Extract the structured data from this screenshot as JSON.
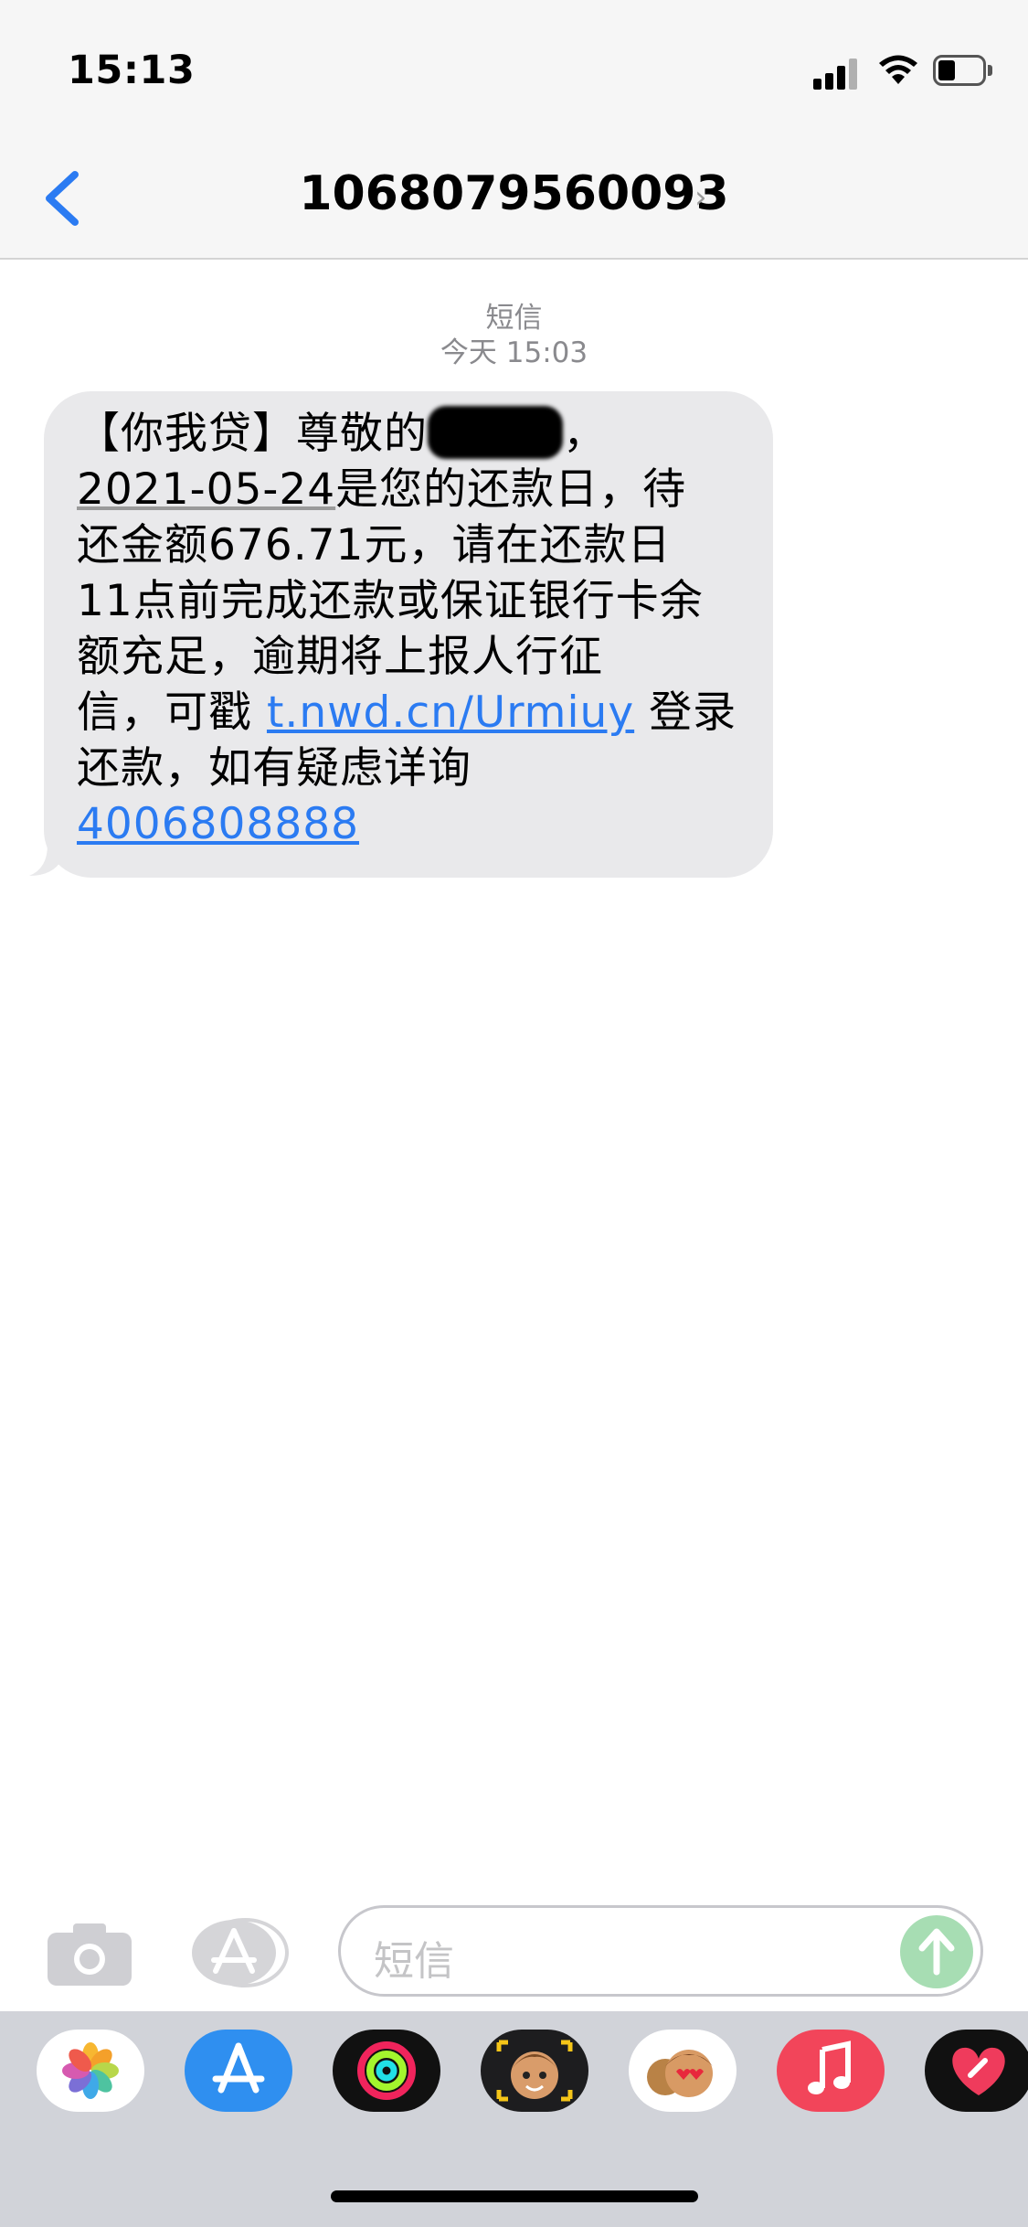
{
  "status_bar": {
    "time": "15:13"
  },
  "nav": {
    "title": "1068079560093",
    "chevron": "›"
  },
  "conversation": {
    "service_label": "短信",
    "timestamp": "今天 15:03"
  },
  "message": {
    "line1_prefix": "【你我贷】尊敬的",
    "line1_suffix": "，",
    "date": "2021-05-24",
    "line2_rest": "是您的还款日，待",
    "line3": "还金额676.71元，请在还款日",
    "line4": "11点前完成还款或保证银行卡余",
    "line5": "额充足，逾期将上报人行征",
    "line6_prefix": "信，可戳 ",
    "url": "t.nwd.cn/Urmiuy",
    "line6_suffix": " 登录",
    "line7": "还款，如有疑虑详询",
    "phone": "4006808888"
  },
  "input": {
    "placeholder": "短信"
  },
  "app_tray": [
    {
      "icon": "photos-icon"
    },
    {
      "icon": "app-store-icon"
    },
    {
      "icon": "activity-icon"
    },
    {
      "icon": "memoji-camera-icon"
    },
    {
      "icon": "memoji-stickers-icon"
    },
    {
      "icon": "music-icon"
    },
    {
      "icon": "digital-touch-icon"
    }
  ],
  "colors": {
    "link": "#2b7bf2",
    "bubble": "#e9e9eb",
    "send": "#a7ddb3",
    "back": "#2b7bf2"
  }
}
